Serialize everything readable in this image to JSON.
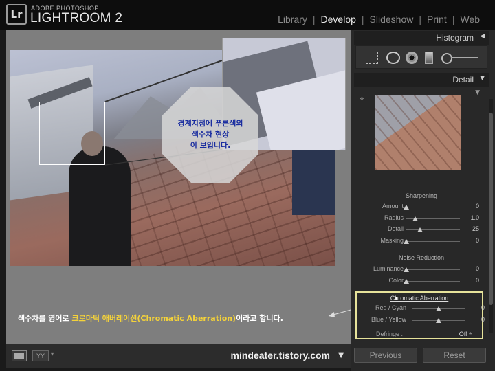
{
  "app": {
    "brand_small": "ADOBE PHOTOSHOP",
    "brand_big": "LIGHTROOM 2",
    "logo": "Lr"
  },
  "modules": [
    {
      "label": "Library",
      "active": false
    },
    {
      "label": "Develop",
      "active": true
    },
    {
      "label": "Slideshow",
      "active": false
    },
    {
      "label": "Print",
      "active": false
    },
    {
      "label": "Web",
      "active": false
    }
  ],
  "annotation": {
    "bubble_text": "경계지점에 푸른색의\n색수차 현상\n이 보입니다.",
    "caption_before": "색수차를 영어로 ",
    "caption_highlight": "크로마틱 애버레이션(Chromatic Aberration)",
    "caption_after": "이라고 합니다."
  },
  "toolbar": {
    "yy_label": "YY",
    "site": "mindeater.tistory.com"
  },
  "panel": {
    "histogram_title": "Histogram",
    "detail_title": "Detail",
    "sharpening": {
      "title": "Sharpening",
      "rows": [
        {
          "label": "Amount",
          "value": "0",
          "pos": 0.0
        },
        {
          "label": "Radius",
          "value": "1.0",
          "pos": 0.17
        },
        {
          "label": "Detail",
          "value": "25",
          "pos": 0.25
        },
        {
          "label": "Masking",
          "value": "0",
          "pos": 0.0
        }
      ]
    },
    "noise": {
      "title": "Noise Reduction",
      "rows": [
        {
          "label": "Luminance",
          "value": "0",
          "pos": 0.0
        },
        {
          "label": "Color",
          "value": "0",
          "pos": 0.0
        }
      ]
    },
    "chromatic": {
      "title": "Chromatic Aberration",
      "rows": [
        {
          "label": "Red / Cyan",
          "value": "0",
          "pos": 0.5
        },
        {
          "label": "Blue / Yellow",
          "value": "0",
          "pos": 0.5
        }
      ],
      "defringe_label": "Defringe :",
      "defringe_value": "Off ÷"
    },
    "previous_label": "Previous",
    "reset_label": "Reset"
  },
  "colors": {
    "highlight": "#f4d23a",
    "bubble_text": "#1a2da0",
    "ca_border": "#e6e29a"
  }
}
